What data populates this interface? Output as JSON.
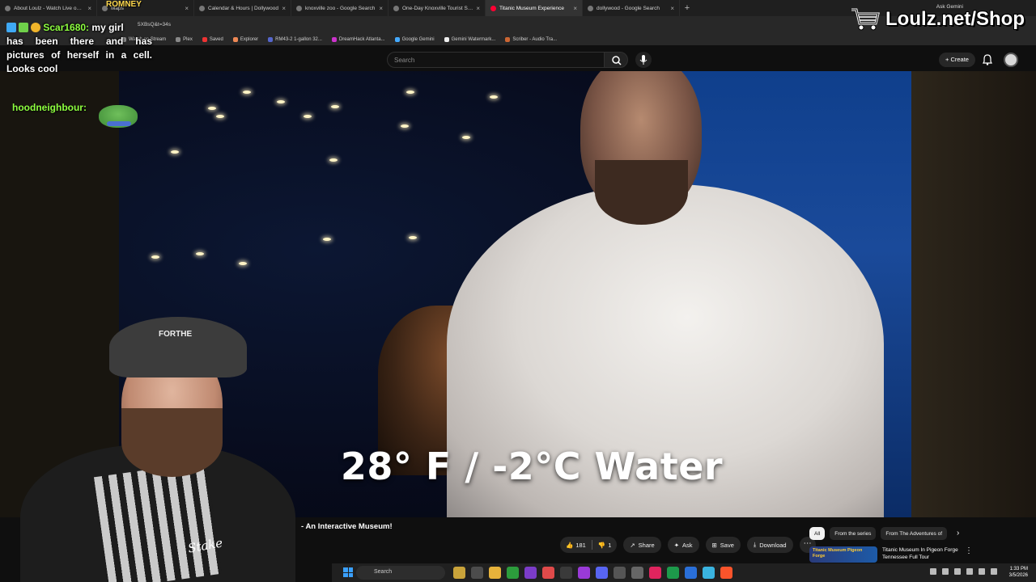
{
  "browser": {
    "tabs": [
      {
        "label": "About Loulz - Watch Live on Ki",
        "active": false
      },
      {
        "label": "Maps",
        "active": false
      },
      {
        "label": "Calendar & Hours | Dollywood",
        "active": false
      },
      {
        "label": "knoxville zoo - Google Search",
        "active": false
      },
      {
        "label": "One-Day Knoxville Tourist Stra",
        "active": false
      },
      {
        "label": "Titanic Museum Experience",
        "active": true
      },
      {
        "label": "dollywood - Google Search",
        "active": false
      }
    ],
    "gemini_button": "Ask Gemini",
    "url_fragment": "5XBsQ&t=34s",
    "bookmarks": [
      "Watch on Stream",
      "Plex",
      "Saved",
      "Explorer",
      "RM43-2 1-gallon 32...",
      "DreamHack Atlanta...",
      "Google Gemini",
      "Gemini Watermark...",
      "Scriber - Audio Tra..."
    ]
  },
  "youtube": {
    "search_placeholder": "Search",
    "create_label": "Create",
    "video_title_fragment": "- An Interactive Museum!",
    "caption_overlay": "28° F / -2°C Water",
    "like_count": "181",
    "dislike_count": "1",
    "actions": {
      "share": "Share",
      "ask": "Ask",
      "save": "Save",
      "download": "Download"
    },
    "chips": [
      "All",
      "From the series",
      "From The Adventures of"
    ],
    "recommendation": {
      "thumb_text": "Titanic Museum Pigeon Forge",
      "title": "Titanic Museum In Pigeon Forge Tennessee Full Tour"
    }
  },
  "stream_overlay": {
    "chat": [
      {
        "user": "Scar1680:",
        "message_start": "my girl",
        "message_rest": "has been there and has pictures of herself in a cell. Looks cool"
      },
      {
        "user": "hoodneighbour:",
        "message_start": "",
        "message_rest": ""
      }
    ],
    "romney_label": "ROMNEY",
    "shop_label": "Loulz.net/Shop",
    "webcam_cap_text": "FORTHE",
    "webcam_shirt_text": "Stake"
  },
  "taskbar": {
    "search_label": "Search",
    "time": "1:33 PM",
    "date": "3/5/2026"
  },
  "colors": {
    "youtube_bg": "#0f0f0f",
    "chat_username": "#8dff3f",
    "video_wall_blue": "#1a4a9a"
  }
}
